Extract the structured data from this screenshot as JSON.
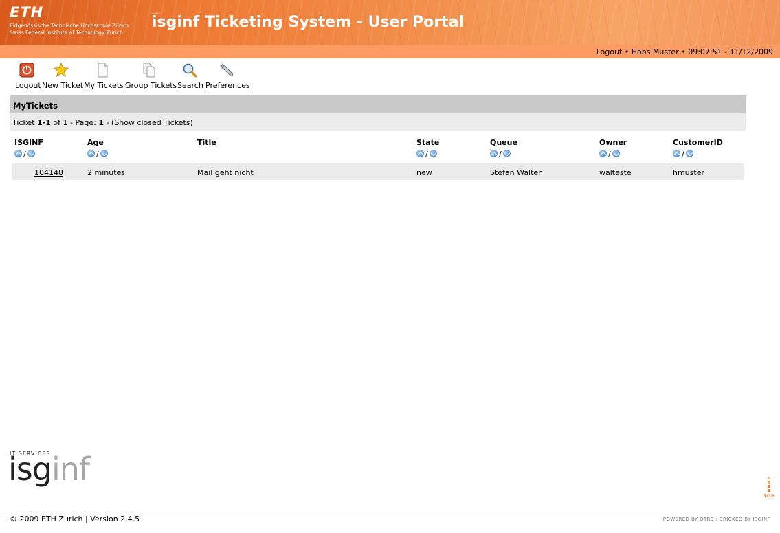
{
  "header": {
    "eth_mark": "ETH",
    "eth_line1": "Eidgenössische Technische Hochschule Zürich",
    "eth_line2": "Swiss Federal Institute of Technology Zurich",
    "title": "isginf Ticketing System - User Portal"
  },
  "infobar": {
    "logout": "Logout",
    "sep1": " • ",
    "user": "Hans Muster",
    "sep2": " • ",
    "datetime": "09:07:51 - 11/12/2009"
  },
  "nav": {
    "items": [
      {
        "label": "Logout",
        "icon": "power-icon"
      },
      {
        "label": "New Ticket",
        "icon": "star-icon"
      },
      {
        "label": "My Tickets",
        "icon": "document-icon"
      },
      {
        "label": "Group Tickets",
        "icon": "documents-icon"
      },
      {
        "label": "Search",
        "icon": "magnifier-icon"
      },
      {
        "label": "Preferences",
        "icon": "wrench-icon"
      }
    ]
  },
  "section": {
    "title": "MyTickets"
  },
  "pager": {
    "prefix": "Ticket ",
    "range": "1-1",
    "of": " of 1 - Page: ",
    "page": "1",
    "dash": " - (",
    "link": "Show closed Tickets",
    "suffix": ")"
  },
  "table": {
    "columns": [
      "ISGINF",
      "Age",
      "Title",
      "State",
      "Queue",
      "Owner",
      "CustomerID"
    ],
    "sort_separator": "/",
    "rows": [
      {
        "id": "104148",
        "age": "2 minutes",
        "title": "Mail geht nicht",
        "state": "new",
        "queue": "Stefan Walter",
        "owner": "walteste",
        "customer": "hmuster"
      }
    ]
  },
  "footer": {
    "logo_top": "IT SERVICES",
    "logo_dark": "isg",
    "logo_light": "inf",
    "top_label": "TOP",
    "copyright": "© 2009 ETH Zurich | Version 2.4.5",
    "powered": "POWERED BY OTRS : BRICKED BY ISGINF"
  },
  "colors": {
    "header_orange": "#ee7a34",
    "infobar_orange": "#fc9b62",
    "section_gray": "#c8c8c8",
    "row_gray": "#ebebeb",
    "sort_blue": "#3a78c5"
  }
}
